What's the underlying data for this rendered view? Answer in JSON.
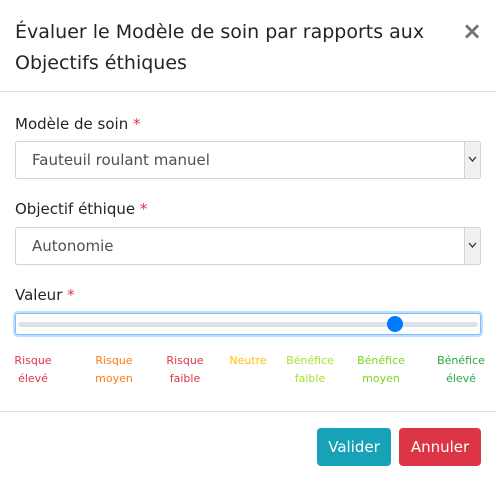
{
  "modal": {
    "title": "Évaluer le Modèle de soin par rapports aux Objectifs éthiques",
    "close_symbol": "×"
  },
  "fields": {
    "care_model": {
      "label": "Modèle de soin",
      "required_marker": "*",
      "value": "Fauteuil roulant manuel"
    },
    "ethical_goal": {
      "label": "Objectif éthique",
      "required_marker": "*",
      "value": "Autonomie"
    },
    "value": {
      "label": "Valeur",
      "required_marker": "*",
      "slider_position_fraction": 0.83
    }
  },
  "scale": [
    {
      "line1": "Risque",
      "line2": "élevé",
      "color": "#dc3545"
    },
    {
      "line1": "Risque",
      "line2": "moyen",
      "color": "#fd7e14"
    },
    {
      "line1": "Risque",
      "line2": "faible",
      "color": "#dc3545"
    },
    {
      "line1": "Neutre",
      "line2": "",
      "color": "#ffc107"
    },
    {
      "line1": "Bénéfice",
      "line2": "faible",
      "color": "#a6e22e"
    },
    {
      "line1": "Bénéfice",
      "line2": "moyen",
      "color": "#7ed321"
    },
    {
      "line1": "Bénéfice",
      "line2": "élevé",
      "color": "#28a745"
    }
  ],
  "buttons": {
    "submit_label": "Valider",
    "cancel_label": "Annuler"
  },
  "colors": {
    "submit": "#17a2b8",
    "cancel": "#dc3545",
    "slider_thumb": "#007bff"
  }
}
